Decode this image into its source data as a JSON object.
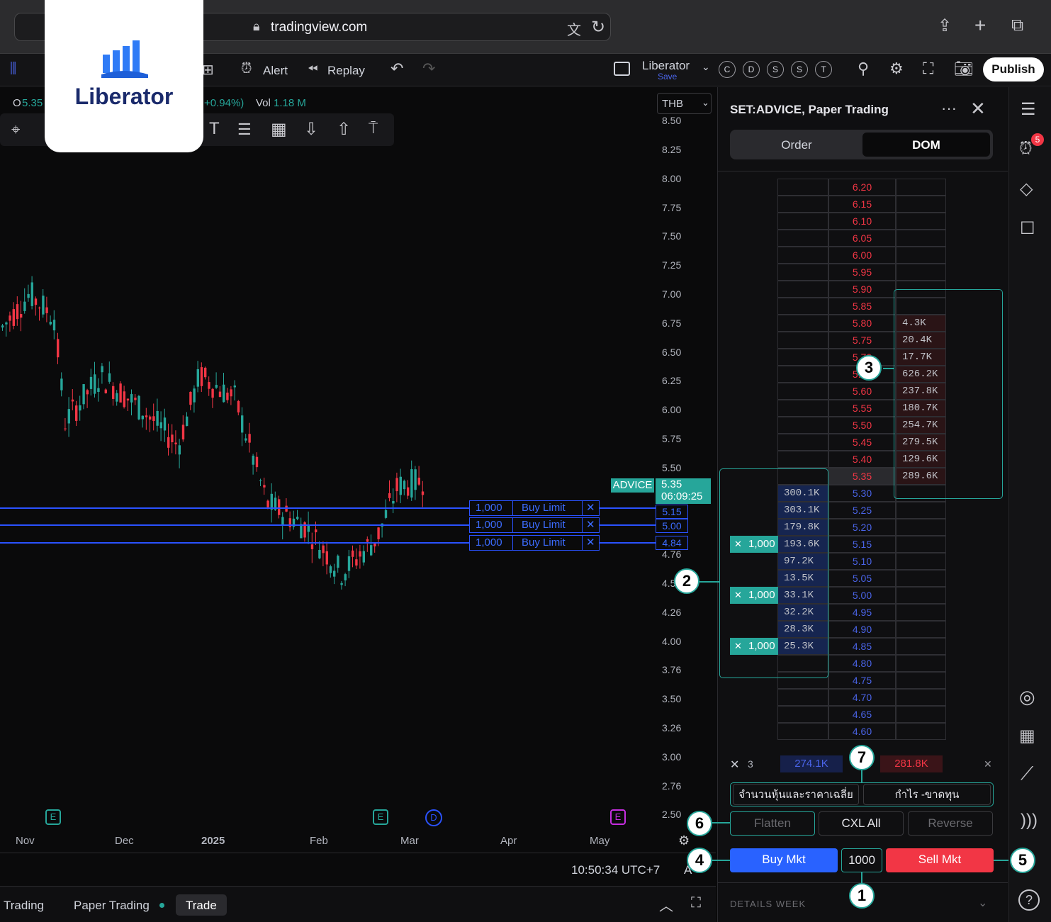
{
  "browser": {
    "url": "tradingview.com"
  },
  "logo": {
    "name": "Liberator"
  },
  "toolbar": {
    "alert_label": "Alert",
    "replay_label": "Replay",
    "layout_name": "Liberator",
    "layout_save": "Save",
    "chart_buttons": [
      "C",
      "D",
      "S",
      "S",
      "T"
    ],
    "publish_label": "Publish"
  },
  "legend": {
    "open_prefix": "O",
    "open_value": "5.35",
    "change": "+0.94%)",
    "vol_label": "Vol",
    "vol_value": "1.18 M"
  },
  "currency": "THB",
  "y_axis": [
    "8.50",
    "8.25",
    "8.00",
    "7.75",
    "7.50",
    "7.25",
    "7.00",
    "6.75",
    "6.50",
    "6.25",
    "6.00",
    "5.75",
    "5.50",
    "4.76",
    "4.5",
    "4.26",
    "4.00",
    "3.76",
    "3.50",
    "3.26",
    "3.00",
    "2.76",
    "2.50"
  ],
  "x_axis": [
    "Nov",
    "Dec",
    "2025",
    "Feb",
    "Mar",
    "Apr",
    "May"
  ],
  "symbol_tag": {
    "name": "ADVICE",
    "price": "5.35",
    "countdown": "06:09:25"
  },
  "orders": [
    {
      "qty": "1,000",
      "type": "Buy Limit",
      "price": "5.15"
    },
    {
      "qty": "1,000",
      "type": "Buy Limit",
      "price": "5.00"
    },
    {
      "qty": "1,000",
      "type": "Buy Limit",
      "price": "4.84"
    }
  ],
  "events": {
    "e1": "E",
    "e2": "E",
    "d": "D",
    "e3": "E"
  },
  "status": {
    "time": "10:50:34 UTC+7",
    "adj": "A"
  },
  "bottom_tabs": [
    "Trading",
    "Paper Trading",
    "Trade"
  ],
  "panel": {
    "title": "SET:ADVICE, Paper Trading",
    "tabs": {
      "order": "Order",
      "dom": "DOM"
    },
    "dom_rows": [
      {
        "price": "6.20",
        "side": "ask",
        "ask": ""
      },
      {
        "price": "6.15",
        "side": "ask",
        "ask": ""
      },
      {
        "price": "6.10",
        "side": "ask",
        "ask": ""
      },
      {
        "price": "6.05",
        "side": "ask",
        "ask": ""
      },
      {
        "price": "6.00",
        "side": "ask",
        "ask": ""
      },
      {
        "price": "5.95",
        "side": "ask",
        "ask": ""
      },
      {
        "price": "5.90",
        "side": "ask",
        "ask": ""
      },
      {
        "price": "5.85",
        "side": "ask",
        "ask": ""
      },
      {
        "price": "5.80",
        "side": "ask",
        "ask": "4.3K"
      },
      {
        "price": "5.75",
        "side": "ask",
        "ask": "20.4K"
      },
      {
        "price": "5.70",
        "side": "ask",
        "ask": "17.7K"
      },
      {
        "price": "5.65",
        "side": "ask",
        "ask": "626.2K"
      },
      {
        "price": "5.60",
        "side": "ask",
        "ask": "237.8K"
      },
      {
        "price": "5.55",
        "side": "ask",
        "ask": "180.7K"
      },
      {
        "price": "5.50",
        "side": "ask",
        "ask": "254.7K"
      },
      {
        "price": "5.45",
        "side": "ask",
        "ask": "279.5K"
      },
      {
        "price": "5.40",
        "side": "ask",
        "ask": "129.6K"
      },
      {
        "price": "5.35",
        "side": "ask",
        "ask": "289.6K"
      },
      {
        "price": "5.30",
        "side": "bid",
        "bid": "300.1K"
      },
      {
        "price": "5.25",
        "side": "bid",
        "bid": "303.1K"
      },
      {
        "price": "5.20",
        "side": "bid",
        "bid": "179.8K"
      },
      {
        "price": "5.15",
        "side": "bid",
        "bid": "193.6K",
        "qty": "1,000"
      },
      {
        "price": "5.10",
        "side": "bid",
        "bid": "97.2K"
      },
      {
        "price": "5.05",
        "side": "bid",
        "bid": "13.5K"
      },
      {
        "price": "5.00",
        "side": "bid",
        "bid": "33.1K",
        "qty": "1,000"
      },
      {
        "price": "4.95",
        "side": "bid",
        "bid": "32.2K"
      },
      {
        "price": "4.90",
        "side": "bid",
        "bid": "28.3K"
      },
      {
        "price": "4.85",
        "side": "bid",
        "bid": "25.3K",
        "qty": "1,000"
      },
      {
        "price": "4.80",
        "side": "bid",
        "bid": ""
      },
      {
        "price": "4.75",
        "side": "bid",
        "bid": ""
      },
      {
        "price": "4.70",
        "side": "bid",
        "bid": ""
      },
      {
        "price": "4.65",
        "side": "bid",
        "bid": ""
      },
      {
        "price": "4.60",
        "side": "bid",
        "bid": ""
      }
    ],
    "summary": {
      "cancel_count": "3",
      "bid_total": "274.1K",
      "ask_total": "281.8K"
    },
    "info_buttons": {
      "shares_avg": "จำนวนหุ้นและราคาเฉลี่ย",
      "pnl": "กำไร -ขาดทุน"
    },
    "action_buttons": {
      "flatten": "Flatten",
      "cxl_all": "CXL All",
      "reverse": "Reverse"
    },
    "trade": {
      "buy_mkt": "Buy Mkt",
      "quantity": "1000",
      "sell_mkt": "Sell Mkt"
    },
    "details": "DETAILS WEEK"
  },
  "annotations": [
    "1",
    "2",
    "3",
    "4",
    "5",
    "6",
    "7"
  ],
  "notifications": {
    "badge": "5"
  },
  "colors": {
    "up": "#26a69a",
    "down": "#f23645",
    "order": "#2a52ff",
    "buy": "#2962ff",
    "sell": "#f23645",
    "accent": "#26a69a"
  }
}
